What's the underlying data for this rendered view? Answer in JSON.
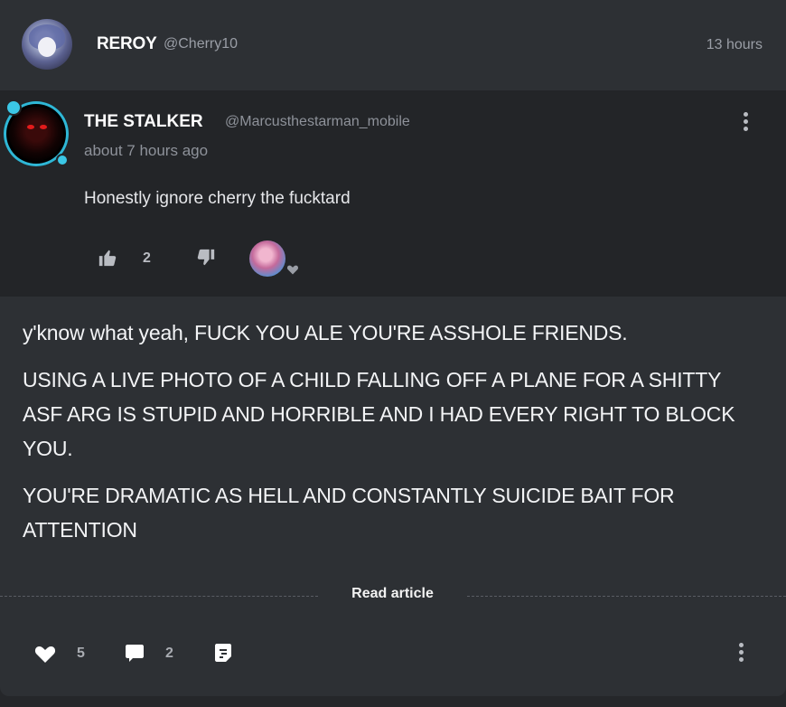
{
  "post": {
    "author": "REROY",
    "handle": "@Cherry10",
    "time": "13 hours",
    "body": [
      "y'know what yeah, FUCK YOU ALE YOU'RE ASSHOLE FRIENDS.",
      "USING A LIVE PHOTO OF A CHILD FALLING OFF A PLANE FOR A SHITTY ASF ARG IS STUPID AND HORRIBLE AND I HAD EVERY RIGHT TO BLOCK YOU.",
      "YOU'RE DRAMATIC AS HELL AND CONSTANTLY SUICIDE BAIT FOR ATTENTION"
    ],
    "read_article_label": "Read article",
    "likes": "5",
    "comments": "2"
  },
  "quoted": {
    "author": "THE STALKER",
    "handle": "@Marcusthestarman_mobile",
    "time": "about 7 hours ago",
    "text": "Honestly ignore cherry the fucktard",
    "likes": "2"
  },
  "icons": {
    "heart": "heart-icon",
    "comment": "comment-icon",
    "share": "share-icon",
    "thumbs_up": "thumbs-up-icon",
    "thumbs_down": "thumbs-down-icon",
    "more": "more-options-icon"
  },
  "colors": {
    "background": "#25272a",
    "card": "#2d3034",
    "embed": "#232528",
    "muted_text": "#9a9ea6",
    "avatar_ring": "#2fb7d6"
  }
}
